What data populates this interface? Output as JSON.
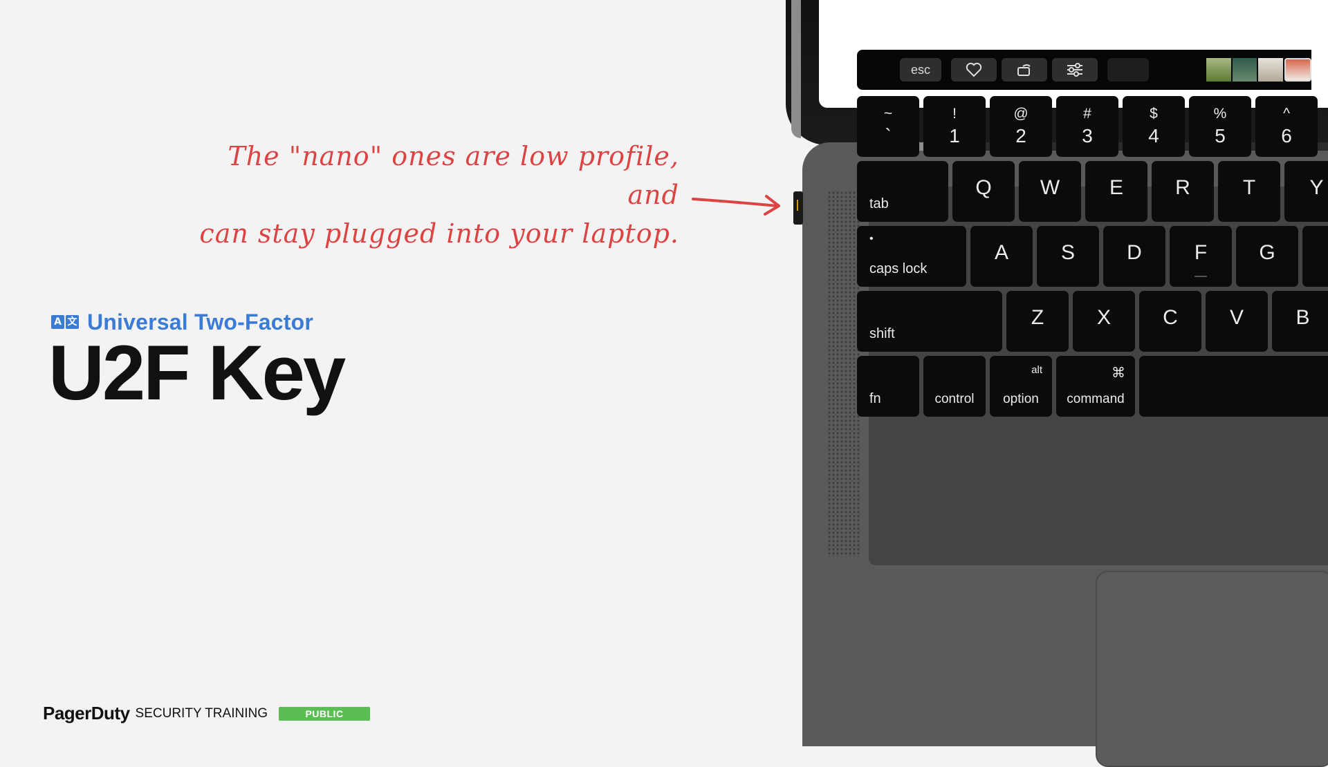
{
  "annotation": {
    "line1": "The \"nano\" ones are low profile, and",
    "line2": "can stay plugged into your laptop.",
    "color": "#dc4444"
  },
  "header": {
    "icon_glyphs": [
      "A",
      "文"
    ],
    "subtitle": "Universal Two-Factor",
    "title": "U2F Key",
    "accent": "#3a7bd5"
  },
  "footer": {
    "brand": "PagerDuty",
    "text": "SECURITY TRAINING",
    "badge": "PUBLIC",
    "badge_color": "#5cbd55"
  },
  "touchbar": {
    "esc": "esc"
  },
  "keyboard": {
    "number_row": [
      {
        "top": "~",
        "bottom": "`"
      },
      {
        "top": "!",
        "bottom": "1"
      },
      {
        "top": "@",
        "bottom": "2"
      },
      {
        "top": "#",
        "bottom": "3"
      },
      {
        "top": "$",
        "bottom": "4"
      },
      {
        "top": "%",
        "bottom": "5"
      },
      {
        "top": "^",
        "bottom": "6"
      }
    ],
    "tab": "tab",
    "qwerty": [
      "Q",
      "W",
      "E",
      "R",
      "T",
      "Y"
    ],
    "caps_dot": "•",
    "caps": "caps lock",
    "asdf": [
      "A",
      "S",
      "D",
      "F",
      "G"
    ],
    "shift": "shift",
    "zxcv": [
      "Z",
      "X",
      "C",
      "V",
      "B"
    ],
    "fn": "fn",
    "control": "control",
    "option_alt": "alt",
    "option": "option",
    "command_symbol": "⌘",
    "command": "command"
  }
}
